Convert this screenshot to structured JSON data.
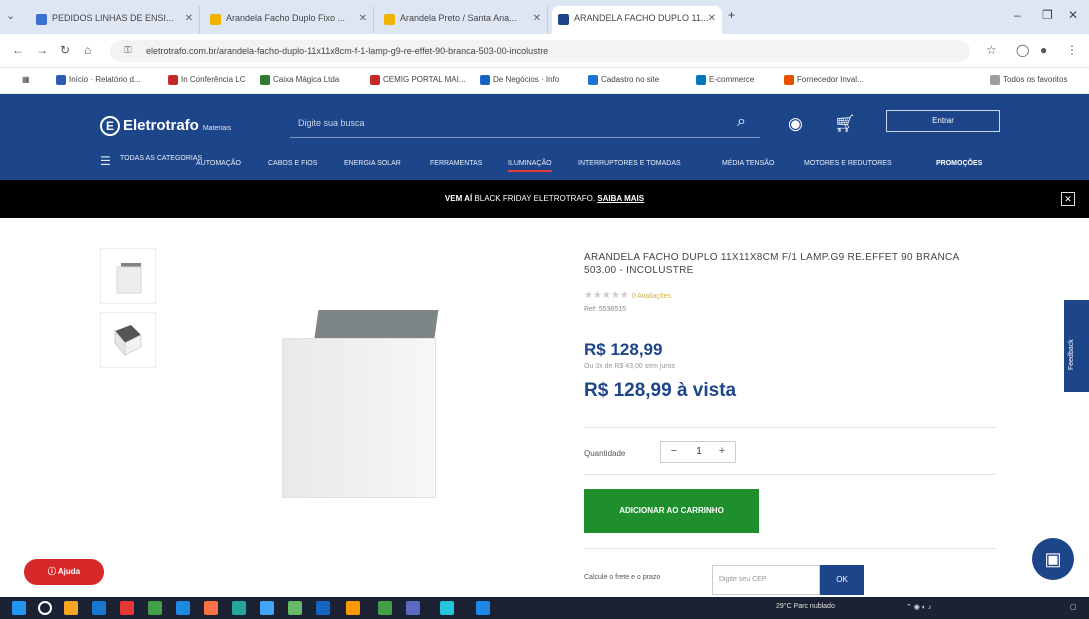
{
  "browser": {
    "tabs": [
      {
        "label": "PEDIDOS LINHAS DE ENSI...",
        "color": "#3b6fd1"
      },
      {
        "label": "Arandela Facho Duplo Fixo ...",
        "color": "#f0b400"
      },
      {
        "label": "Arandela Preto / Santa Ana...",
        "color": "#f0b400"
      },
      {
        "label": "ARANDELA FACHO DUPLO 11...",
        "color": "#1d4589"
      }
    ],
    "new_tab": "+",
    "url": "eletrotrafo.com.br/arandela-facho-duplo-11x11x8cm-f-1-lamp-g9-re-effet-90-branca-503-00-incolustre",
    "bookmarks": [
      {
        "label": "Início · Relatório d...",
        "color": "#2f5bb7"
      },
      {
        "label": "In Conferência LC",
        "color": "#c62828"
      },
      {
        "label": "Caixa Mágica Ltda",
        "color": "#2e7d32"
      },
      {
        "label": "CEMIG PORTAL MAI...",
        "color": "#c62828"
      },
      {
        "label": "De Negócios · Info",
        "color": "#1565c0"
      },
      {
        "label": "Cadastro no site",
        "color": "#1976d2"
      },
      {
        "label": "E-commerce",
        "color": "#0277bd"
      },
      {
        "label": "Fornecedor Inval...",
        "color": "#e65100"
      }
    ],
    "bookmarks_right": "Todos os favoritos"
  },
  "header": {
    "logo": "Eletrotrafo",
    "logo_sub": "Materiais",
    "search_placeholder": "Digite sua busca",
    "login_label": "Entrar",
    "all_categories": "TODAS AS CATEGORIAS",
    "categories": [
      {
        "label": "AUTOMAÇÃO"
      },
      {
        "label": "CABOS E FIOS"
      },
      {
        "label": "ENERGIA SOLAR"
      },
      {
        "label": "FERRAMENTAS"
      },
      {
        "label": "ILUMINAÇÃO",
        "active": true
      },
      {
        "label": "INTERRUPTORES E TOMADAS"
      },
      {
        "label": "MÉDIA TENSÃO"
      },
      {
        "label": "MOTORES E REDUTORES"
      },
      {
        "label": "PROMOÇÕES",
        "promo": true
      }
    ]
  },
  "banner": {
    "prefix": "VEM AÍ",
    "text": "BLACK FRIDAY ELETROTRAFO.",
    "link": "SAIBA MAIS"
  },
  "product": {
    "title": "ARANDELA FACHO DUPLO 11X11X8CM F/1 LAMP.G9 RE.EFFET 90 BRANCA 503.00 - INCOLUSTRE",
    "stars": "★★★★★",
    "reviews": "0 Avaliações",
    "ref": "Ref: 5536515",
    "price": "R$ 128,99",
    "installment": "Ou 3x de R$ 43,00 sem juros",
    "cash_price": "R$ 128,99 à vista",
    "qty_label": "Quantidade",
    "qty_value": "1",
    "add_to_cart": "ADICIONAR AO CARRINHO",
    "shipping_label": "Calcule o frete e o prazo",
    "cep_placeholder": "Digite seu CEP",
    "ok": "OK"
  },
  "widgets": {
    "feedback": "Feedback",
    "help": "Ajuda"
  },
  "taskbar": {
    "weather": "29°C Parc nublado",
    "icon_colors": [
      "#2196f3",
      "#ffffff",
      "#f9a825",
      "#1976d2",
      "#e53935",
      "#43a047",
      "#1e88e5",
      "#ff7043",
      "#26a69a",
      "#42a5f5",
      "#66bb6a",
      "#1565c0"
    ]
  }
}
